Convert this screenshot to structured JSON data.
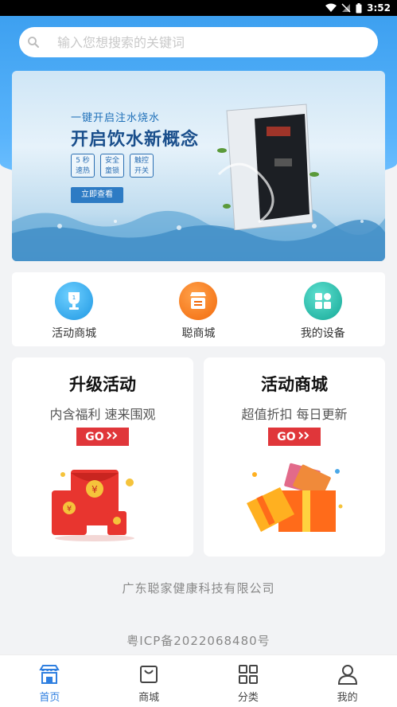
{
  "status_bar": {
    "time": "3:52"
  },
  "search": {
    "placeholder": "输入您想搜索的关键词"
  },
  "banner": {
    "subtitle": "一键开启注水烧水",
    "headline": "开启饮水新概念",
    "tags": [
      "5 秒\n速热",
      "安全\n童锁",
      "触控\n开关"
    ],
    "cta": "立即查看"
  },
  "quick_entries": [
    {
      "label": "活动商城",
      "icon": "trophy-top1-icon",
      "color": "#2ea8ec"
    },
    {
      "label": "聪商城",
      "icon": "store-icon",
      "color": "#ff7a1a"
    },
    {
      "label": "我的设备",
      "icon": "device-grid-icon",
      "color": "#1fb8a6"
    }
  ],
  "cards": [
    {
      "title": "升级活动",
      "subtitle": "内含福利 速来围观",
      "go": "GO",
      "art": "red-envelope-illustration"
    },
    {
      "title": "活动商城",
      "subtitle": "超值折扣 每日更新",
      "go": "GO",
      "art": "gift-box-illustration"
    }
  ],
  "footer": {
    "company": "广东聪家健康科技有限公司",
    "icp": "粤ICP备2022068480号"
  },
  "tabbar": [
    {
      "label": "首页",
      "icon": "home-store-icon",
      "active": true
    },
    {
      "label": "商城",
      "icon": "shop-bag-icon",
      "active": false
    },
    {
      "label": "分类",
      "icon": "category-grid-icon",
      "active": false
    },
    {
      "label": "我的",
      "icon": "user-icon",
      "active": false
    }
  ],
  "colors": {
    "accent": "#2f7fe0",
    "header_blue": "#3da0f0",
    "go_red": "#e0363a"
  }
}
